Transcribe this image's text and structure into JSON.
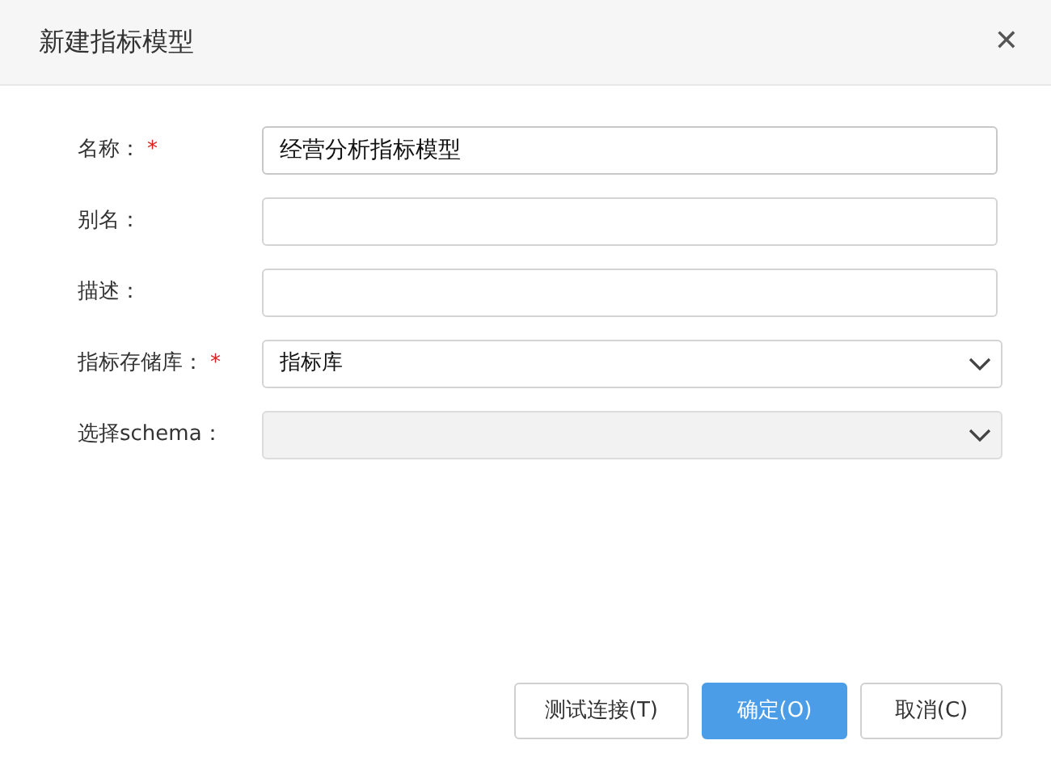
{
  "dialog": {
    "title": "新建指标模型",
    "close": "✕"
  },
  "fields": [
    {
      "kind": "input",
      "label": "名称：",
      "required_mark": "*",
      "value": "经营分析指标模型",
      "focused": true
    },
    {
      "kind": "input",
      "label": "别名："
    },
    {
      "kind": "input",
      "label": "描述："
    },
    {
      "kind": "select",
      "label": "指标存储库：",
      "required_mark": "*",
      "value": "指标库",
      "disabled": false
    },
    {
      "kind": "select",
      "label": "选择schema：",
      "disabled": true
    }
  ],
  "buttons": [
    {
      "label": "测试连接(T)",
      "kind": "default"
    },
    {
      "label": "确定(O)",
      "kind": "primary"
    },
    {
      "label": "取消(C)",
      "kind": "default"
    }
  ]
}
